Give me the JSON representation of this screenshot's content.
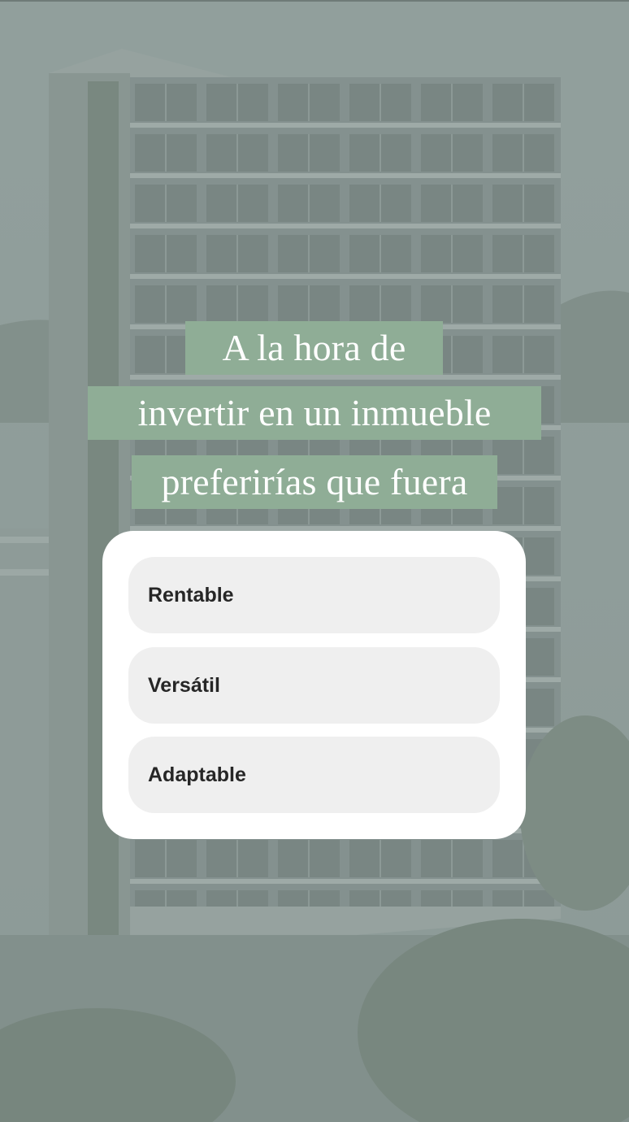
{
  "story": {
    "headline_lines": [
      "A la hora de",
      "invertir en un inmueble",
      "preferirías que fuera"
    ],
    "highlight_color": "#8fad96",
    "background_image": "building-photo"
  },
  "poll": {
    "options": [
      {
        "label": "Rentable"
      },
      {
        "label": "Versátil"
      },
      {
        "label": "Adaptable"
      }
    ]
  }
}
